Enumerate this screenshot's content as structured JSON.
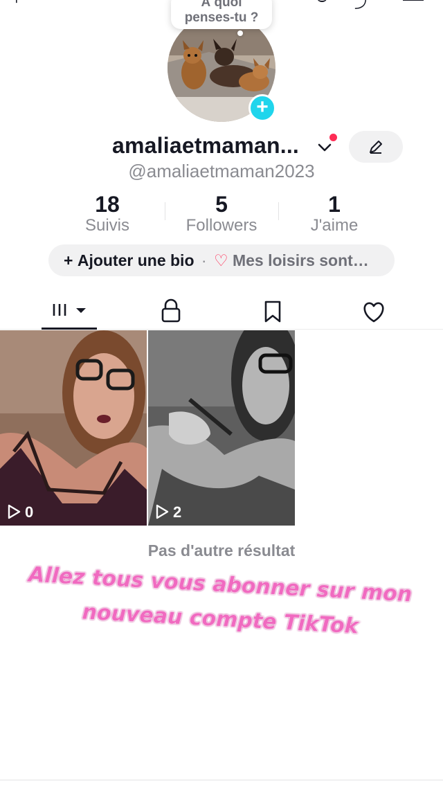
{
  "bubble": {
    "line1": "À quoi",
    "line2": "penses-tu ?"
  },
  "profile": {
    "display_name": "amaliaetmaman...",
    "handle": "@amaliaetmaman2023",
    "add_icon": "plus-icon"
  },
  "stats": [
    {
      "value": "18",
      "label": "Suivis"
    },
    {
      "value": "5",
      "label": "Followers"
    },
    {
      "value": "1",
      "label": "J'aime"
    }
  ],
  "bio": {
    "plus": "+",
    "add_label": "Ajouter une bio",
    "separator": "·",
    "heart": "♡",
    "hobbies_label": "Mes loisirs sont…"
  },
  "tabs": [
    {
      "name": "videos-tab",
      "icon": "grid-icon"
    },
    {
      "name": "private-tab",
      "icon": "lock-icon"
    },
    {
      "name": "saved-tab",
      "icon": "bookmark-icon"
    },
    {
      "name": "liked-tab",
      "icon": "heart-icon"
    }
  ],
  "videos": [
    {
      "views": "0"
    },
    {
      "views": "2"
    }
  ],
  "no_more": "Pas d'autre résultat",
  "promo": {
    "line1": "Allez tous vous abonner sur mon",
    "line2": "nouveau compte TikTok"
  },
  "colors": {
    "accent_pink": "#fe2c55",
    "add_blue": "#20d5ec",
    "promo_pink": "#f06ac0"
  }
}
